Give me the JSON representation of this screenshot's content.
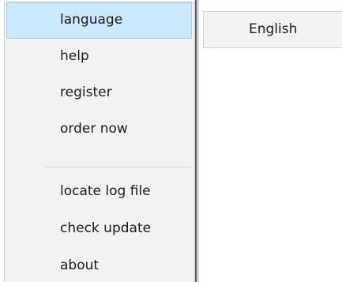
{
  "menu": {
    "items": [
      {
        "label": "language",
        "highlighted": true,
        "has_submenu": true
      },
      {
        "label": "help"
      },
      {
        "label": "register"
      },
      {
        "label": "order now"
      },
      {
        "label": "locate log file"
      },
      {
        "label": "check update"
      },
      {
        "label": "about"
      }
    ]
  },
  "submenu": {
    "items": [
      {
        "label": "English"
      }
    ]
  },
  "colors": {
    "menu_background": "#f2f2f2",
    "highlight_background": "#cce8ff",
    "highlight_border": "#99d1ff",
    "text": "#1a1a1a"
  }
}
